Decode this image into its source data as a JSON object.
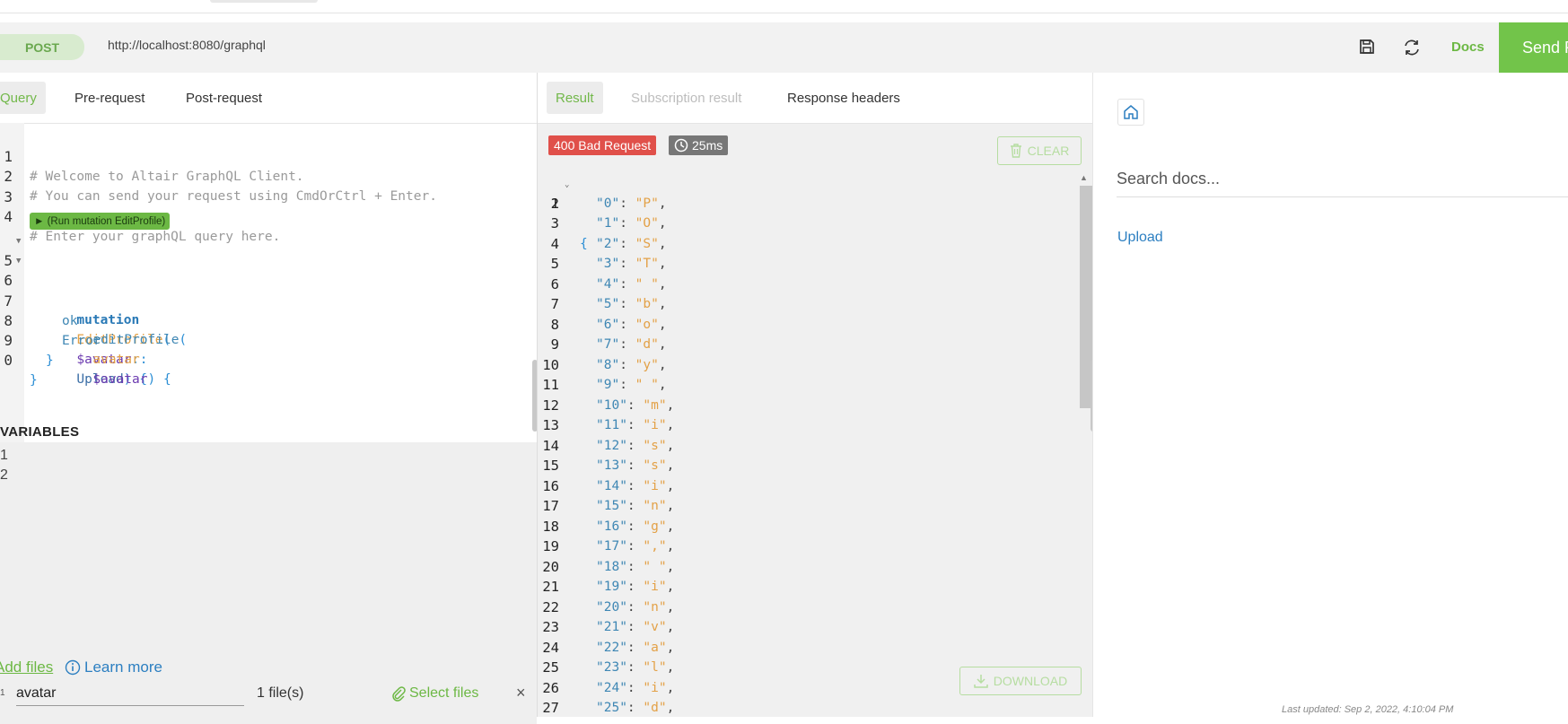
{
  "url_bar": {
    "method": "POST",
    "url": "http://localhost:8080/graphql",
    "docs_label": "Docs",
    "send_label": "Send R"
  },
  "query_pane": {
    "tabs": [
      {
        "label": "Query",
        "active": true
      },
      {
        "label": "Pre-request",
        "active": false
      },
      {
        "label": "Post-request",
        "active": false
      }
    ],
    "run_mutation_label": "► (Run mutation EditProfile)",
    "line_numbers": [
      "1",
      "2",
      "3",
      "4",
      "5",
      "6",
      "7",
      "8",
      "9",
      "0"
    ],
    "code": {
      "l1": "# Welcome to Altair GraphQL Client.",
      "l2": "# You can send your request using CmdOrCtrl + Enter.",
      "l4": "# Enter your graphQL query here.",
      "l5_kw": "mutation",
      "l5_name": "EditProfile",
      "l5_paren": "(",
      "l5_var": "$avatar",
      "l5_colon": ":",
      "l5_type": "Upload",
      "l5_close": ") {",
      "l6_field": "editProfile",
      "l6_paren": "(",
      "l6_arg": "avatar",
      "l6_colon": ":",
      "l6_var": "$avatar",
      "l6_close": ") {",
      "l7": "ok",
      "l8": "Error",
      "l9": "}",
      "l10": "}"
    },
    "variables_title": "VARIABLES",
    "variables_line_numbers": [
      "1",
      "2"
    ],
    "files": {
      "add_files_label": "Add files",
      "learn_more_label": "Learn more",
      "rows": [
        {
          "index": "1",
          "name": "avatar",
          "count_label": "1 file(s)",
          "select_label": "Select files",
          "remove_label": "×"
        }
      ]
    }
  },
  "result_pane": {
    "tabs": [
      {
        "label": "Result",
        "active": true
      },
      {
        "label": "Subscription result",
        "active": false,
        "disabled": true
      },
      {
        "label": "Response headers",
        "active": false
      }
    ],
    "status": "400 Bad Request",
    "time": "25ms",
    "clear_label": "CLEAR",
    "download_label": "DOWNLOAD",
    "open_brace": "{",
    "entries": [
      {
        "k": "0",
        "v": "P"
      },
      {
        "k": "1",
        "v": "O"
      },
      {
        "k": "2",
        "v": "S"
      },
      {
        "k": "3",
        "v": "T"
      },
      {
        "k": "4",
        "v": " "
      },
      {
        "k": "5",
        "v": "b"
      },
      {
        "k": "6",
        "v": "o"
      },
      {
        "k": "7",
        "v": "d"
      },
      {
        "k": "8",
        "v": "y"
      },
      {
        "k": "9",
        "v": " "
      },
      {
        "k": "10",
        "v": "m"
      },
      {
        "k": "11",
        "v": "i"
      },
      {
        "k": "12",
        "v": "s"
      },
      {
        "k": "13",
        "v": "s"
      },
      {
        "k": "14",
        "v": "i"
      },
      {
        "k": "15",
        "v": "n"
      },
      {
        "k": "16",
        "v": "g"
      },
      {
        "k": "17",
        "v": ","
      },
      {
        "k": "18",
        "v": " "
      },
      {
        "k": "19",
        "v": "i"
      },
      {
        "k": "20",
        "v": "n"
      },
      {
        "k": "21",
        "v": "v"
      },
      {
        "k": "22",
        "v": "a"
      },
      {
        "k": "23",
        "v": "l"
      },
      {
        "k": "24",
        "v": "i"
      },
      {
        "k": "25",
        "v": "d"
      }
    ]
  },
  "docs_pane": {
    "search_placeholder": "Search docs...",
    "upload_link": "Upload",
    "last_updated": "Last updated: Sep 2, 2022, 4:10:04 PM"
  },
  "colors": {
    "accent_green": "#72c44a",
    "error_red": "#e0504a",
    "link_blue": "#2c7fc1"
  },
  "icons": [
    "save-icon",
    "refresh-icon",
    "home-icon",
    "info-icon",
    "paperclip-icon",
    "trash-icon",
    "download-icon",
    "clock-icon",
    "chevron-down-icon"
  ]
}
